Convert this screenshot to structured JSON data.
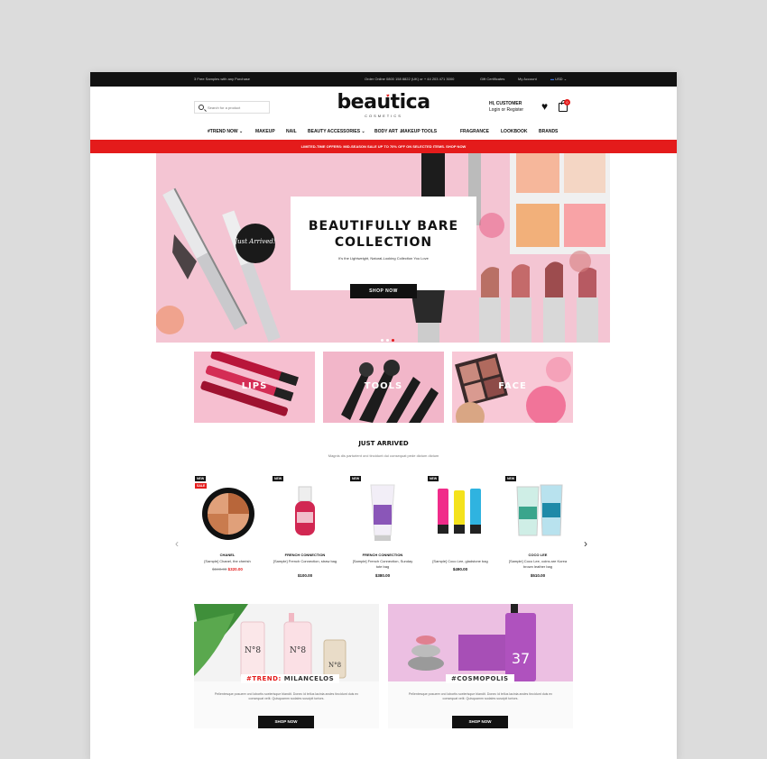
{
  "topbar": {
    "left": "3 Free Samples with any Purchase",
    "phone": "Order Online 0800 158 8822 (UK) or + 44 203 471 3000",
    "gift": "Gift Certificates",
    "account": "My Account",
    "currency": "USD"
  },
  "header": {
    "search_placeholder": "Search for a product",
    "logo_name": "beautica",
    "logo_sub": "COSMETICS",
    "greeting": "HI, CUSTOMER",
    "login": "Login or Register",
    "cart_count": "0"
  },
  "nav": [
    "#TREND NOW ⌄",
    "MAKEUP",
    "NAIL",
    "BEAUTY ACCESSORIES ⌄",
    "BODY ART ⌄",
    "MAKEUP TOOLS",
    "FRAGRANCE",
    "LOOKBOOK",
    "BRANDS"
  ],
  "promo": "LIMITED-TIME OFFERS: MID-SEASON SALE UP TO 70% OFF ON SELECTED ITEMS. SHOP NOW",
  "hero": {
    "line1": "BEAUTIFULLY BARE",
    "line2": "COLLECTION",
    "subtitle": "It's the Lightweight, Natural-Looking Collection You Love",
    "button": "SHOP NOW",
    "sticker": "Just Arrived!"
  },
  "categories": [
    "LIPS",
    "TOOLS",
    "FACE"
  ],
  "just_arrived": {
    "title": "JUST ARRIVED",
    "subtitle": "Magnis dis parturient orci tincidunt dui consequat pede dictum dictum",
    "products": [
      {
        "tag": "NEW",
        "sale": "SALE",
        "brand": "CHANEL",
        "name": "[Sample] Chanel, the cherish",
        "old_price": "$340.00",
        "price": "$320.00"
      },
      {
        "tag": "NEW",
        "brand": "FRENCH CONNECTION",
        "name": "[Sample] French Connection, straw bag",
        "price": "$100.00"
      },
      {
        "tag": "NEW",
        "brand": "FRENCH CONNECTION",
        "name": "[Sample] French Connection, Sunday tote bag",
        "price": "$380.00"
      },
      {
        "tag": "NEW",
        "brand": "",
        "name": "[Sample] Coco Lee, gladstone bag",
        "price": "$490.00"
      },
      {
        "tag": "NEW",
        "brand": "COCO LEE",
        "name": "[Sample] Coco Lee, coins are Korea brown leather bag",
        "price": "$510.00"
      }
    ]
  },
  "trends": [
    {
      "hash": "#TREND:",
      "name": "MILANCELOS",
      "desc": "Pellentesque posuere orci lobortis scelerisque blandit. Donec id tellus lacinia andes tincidunt duis ex consequat velit. Quisquamm sodales suscipit tortors.",
      "button": "SHOP NOW"
    },
    {
      "hash": "",
      "name": "#COSMOPOLIS",
      "desc": "Pellentesque posuere orci lobortis scelerisque blandit. Donec id tellus lacinia andes tincidunt duis ex consequat velit. Quisquamm sodales suscipit tortors.",
      "button": "SHOP NOW"
    }
  ],
  "colors": {
    "accent": "#e41b1b",
    "hero_bg": "#f4c5d3",
    "dark": "#111111"
  }
}
